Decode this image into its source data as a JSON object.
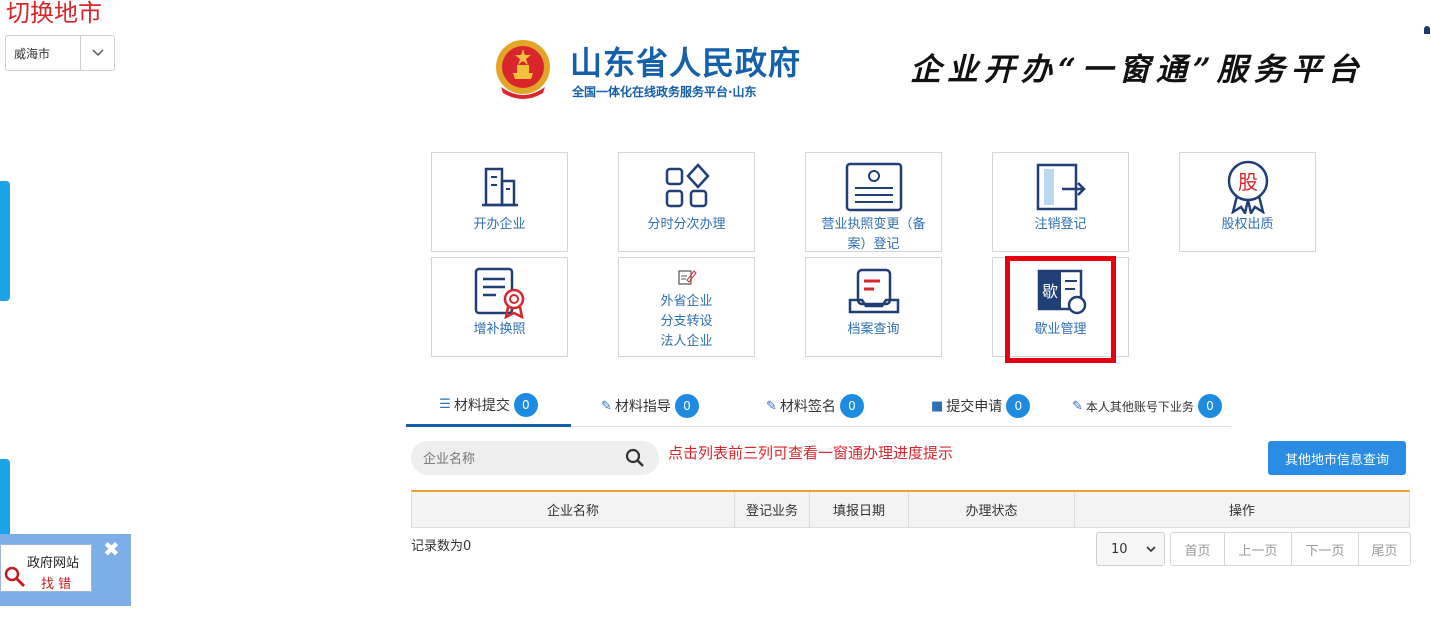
{
  "city": {
    "title": "切换地市",
    "selected": "威海市"
  },
  "header": {
    "gov_title": "山东省人民政府",
    "gov_subtitle": "全国一体化在线政务服务平台·山东",
    "platform_title": "企业开办“一窗通”服务平台"
  },
  "tiles": [
    {
      "label": "开办企业",
      "icon": "building-icon"
    },
    {
      "label": "分时分次办理",
      "icon": "grid-apps-icon"
    },
    {
      "label": "营业执照变更（备案）登记",
      "icon": "license-card-icon"
    },
    {
      "label": "注销登记",
      "icon": "exit-document-icon"
    },
    {
      "label": "股权出质",
      "icon": "equity-badge-icon"
    },
    {
      "label": "增补换照",
      "icon": "certificate-icon"
    },
    {
      "label": "外省企业\n分支转设\n法人企业",
      "icon": "edit-note-icon"
    },
    {
      "label": "档案查询",
      "icon": "archive-tray-icon"
    },
    {
      "label": "歇业管理",
      "icon": "suspension-card-icon",
      "icon_char": "歇"
    }
  ],
  "equity_char": "股",
  "tabs": [
    {
      "label": "材料提交",
      "count": "0"
    },
    {
      "label": "材料指导",
      "count": "0"
    },
    {
      "label": "材料签名",
      "count": "0"
    },
    {
      "label": "提交申请",
      "count": "0"
    },
    {
      "label": "本人其他账号下业务",
      "count": "0"
    }
  ],
  "search": {
    "placeholder": "企业名称"
  },
  "hint": "点击列表前三列可查看一窗通办理进度提示",
  "other_city_button": "其他地市信息查询",
  "table": {
    "headers": [
      "企业名称",
      "登记业务",
      "填报日期",
      "办理状态",
      "操作"
    ]
  },
  "records_text": "记录数为0",
  "pagination": {
    "page_size": "10",
    "first": "首页",
    "prev": "上一页",
    "next": "下一页",
    "last": "尾页"
  },
  "feedback": {
    "line1": "政府网站",
    "line2": "找 错"
  },
  "colors": {
    "brand_blue": "#1460aa",
    "accent_blue": "#2a8de3",
    "red": "#d9262c",
    "highlight": "#e60012"
  }
}
